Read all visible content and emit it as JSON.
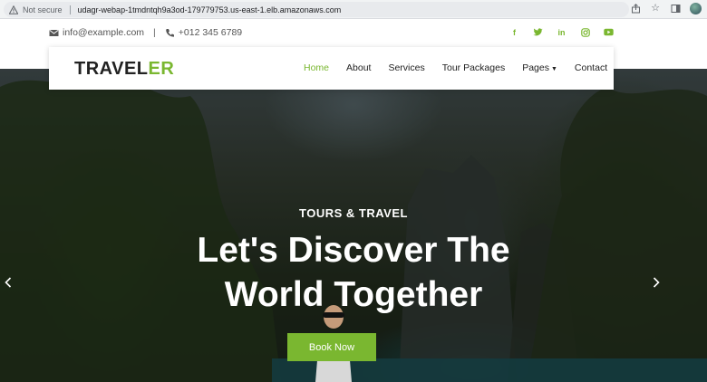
{
  "browser": {
    "security_label": "Not secure",
    "url": "udagr-webap-1tmdntqh9a3od-179779753.us-east-1.elb.amazonaws.com"
  },
  "topbar": {
    "email": "info@example.com",
    "separator": "|",
    "phone": "+012 345 6789",
    "socials": [
      "facebook-icon",
      "twitter-icon",
      "linkedin-icon",
      "instagram-icon",
      "youtube-icon"
    ],
    "accent_color": "#7ab730"
  },
  "navbar": {
    "logo_main": "TRAVEL",
    "logo_accent": "ER",
    "items": [
      {
        "label": "Home",
        "active": true
      },
      {
        "label": "About",
        "active": false
      },
      {
        "label": "Services",
        "active": false
      },
      {
        "label": "Tour Packages",
        "active": false
      },
      {
        "label": "Pages",
        "active": false
      },
      {
        "label": "Contact",
        "active": false
      }
    ]
  },
  "hero": {
    "subtitle": "TOURS & TRAVEL",
    "title_line1": "Let's Discover The",
    "title_line2": "World Together",
    "cta": "Book Now"
  }
}
